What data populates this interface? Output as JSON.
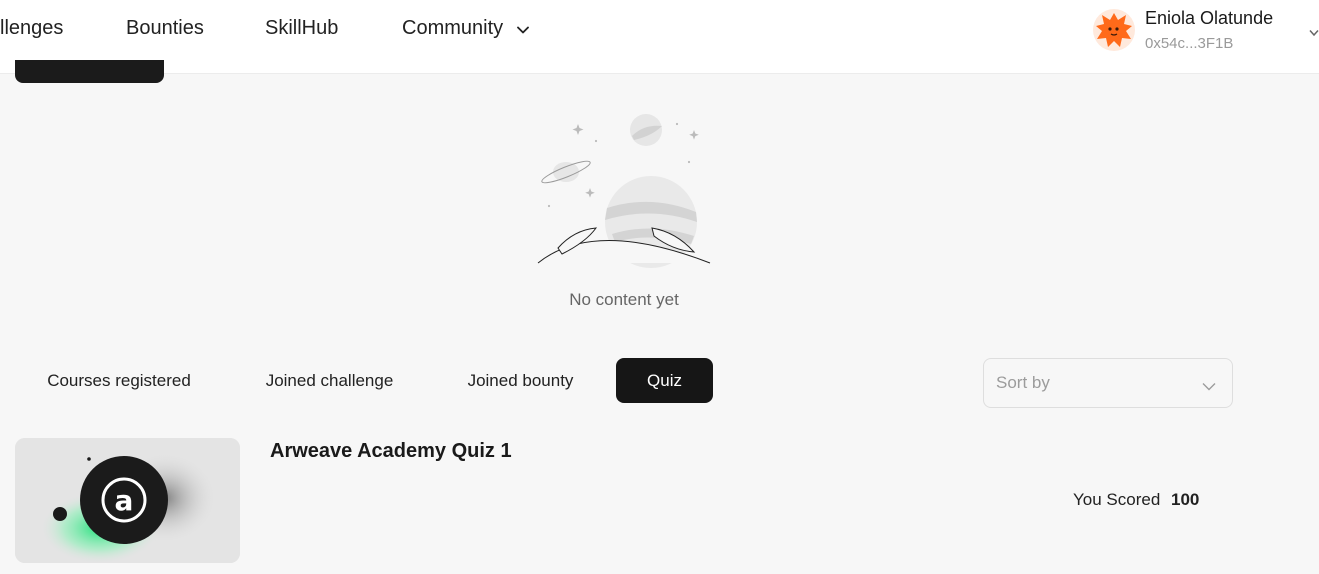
{
  "nav": {
    "items": [
      {
        "label": "llenges"
      },
      {
        "label": "Bounties"
      },
      {
        "label": "SkillHub"
      },
      {
        "label": "Community"
      }
    ]
  },
  "user": {
    "name": "Eniola Olatunde",
    "address": "0x54c...3F1B",
    "avatar_icon": "fox-avatar-icon"
  },
  "empty_state": {
    "text": "No content yet",
    "illustration_icon": "planets-empty-illustration"
  },
  "tabs": [
    {
      "label": "Courses registered",
      "active": false
    },
    {
      "label": "Joined challenge",
      "active": false
    },
    {
      "label": "Joined bounty",
      "active": false
    },
    {
      "label": "Quiz",
      "active": true
    }
  ],
  "sort": {
    "placeholder": "Sort by"
  },
  "quiz": {
    "title": "Arweave Academy Quiz 1",
    "score_label": "You Scored",
    "score_value": "100",
    "thumbnail_icon": "arweave-logo-icon"
  },
  "colors": {
    "accent_dark": "#161616",
    "background": "#f7f7f7",
    "avatar_orange": "#ff6a1a"
  }
}
